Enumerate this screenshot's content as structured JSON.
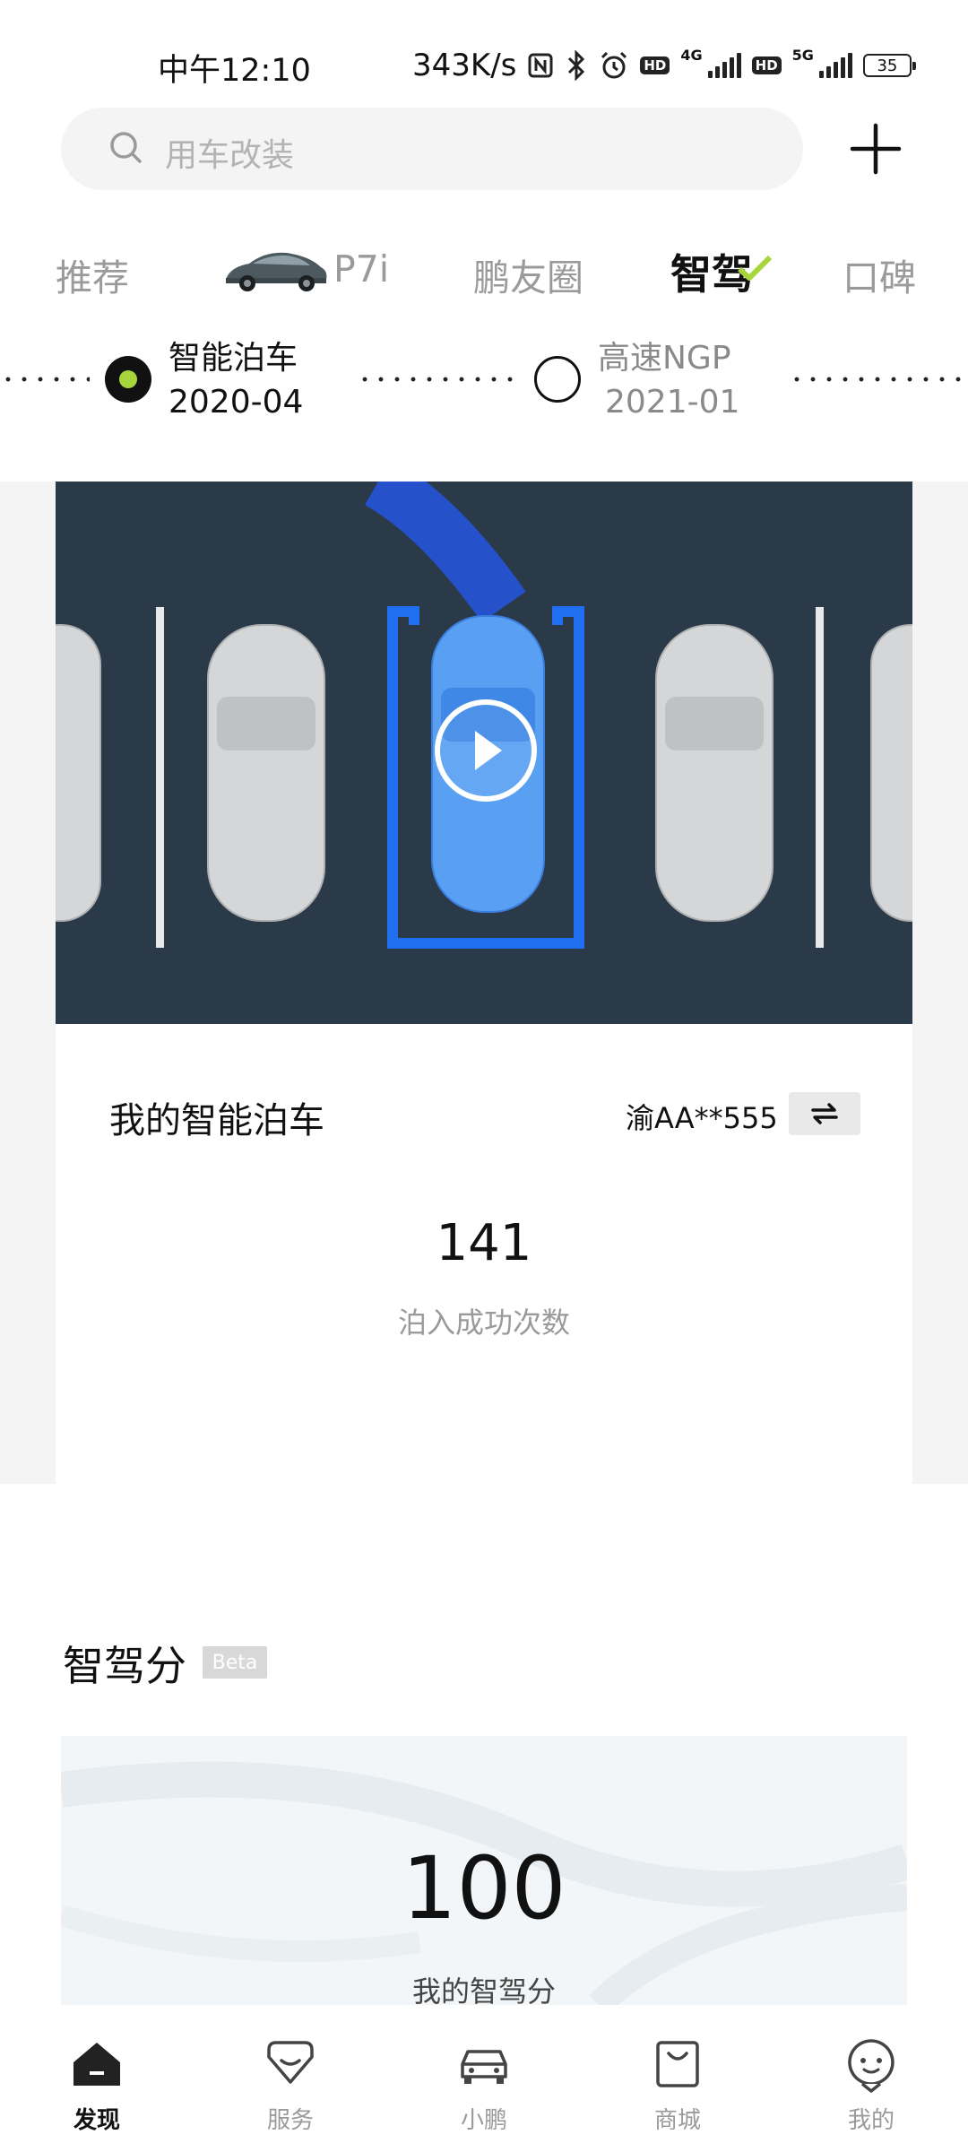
{
  "status_bar": {
    "time": "中午12:10",
    "speed": "343K/s",
    "hd_label": "HD",
    "net_4g": "4G",
    "net_5g": "5G",
    "battery": "35",
    "icons": [
      "nfc-icon",
      "bluetooth-icon",
      "alarm-icon",
      "signal-icon",
      "battery-icon"
    ]
  },
  "search": {
    "placeholder": "用车改装"
  },
  "tabs": [
    {
      "label": "推荐",
      "active": false
    },
    {
      "label": "P7i",
      "active": false
    },
    {
      "label": "鹏友圈",
      "active": false
    },
    {
      "label": "智驾",
      "active": true
    },
    {
      "label": "口碑",
      "active": false
    }
  ],
  "timeline": [
    {
      "title": "智能泊车",
      "date": "2020-04",
      "active": true
    },
    {
      "title": "高速NGP",
      "date": "2021-01",
      "active": false
    }
  ],
  "parking_card": {
    "title": "我的智能泊车",
    "plate": "渝AA**555",
    "count": "141",
    "count_label": "泊入成功次数"
  },
  "score": {
    "title": "智驾分",
    "badge": "Beta",
    "value": "100",
    "label": "我的智驾分"
  },
  "bottom_nav": [
    {
      "label": "发现",
      "icon": "home-icon",
      "active": true
    },
    {
      "label": "服务",
      "icon": "service-heart-icon",
      "active": false
    },
    {
      "label": "小鹏",
      "icon": "car-icon",
      "active": false
    },
    {
      "label": "商城",
      "icon": "shopping-bag-icon",
      "active": false
    },
    {
      "label": "我的",
      "icon": "profile-face-icon",
      "active": false
    }
  ],
  "colors": {
    "accent_green": "#a6d63c",
    "highlight_blue": "#1f6ff0",
    "video_bg": "#2b3a48"
  }
}
